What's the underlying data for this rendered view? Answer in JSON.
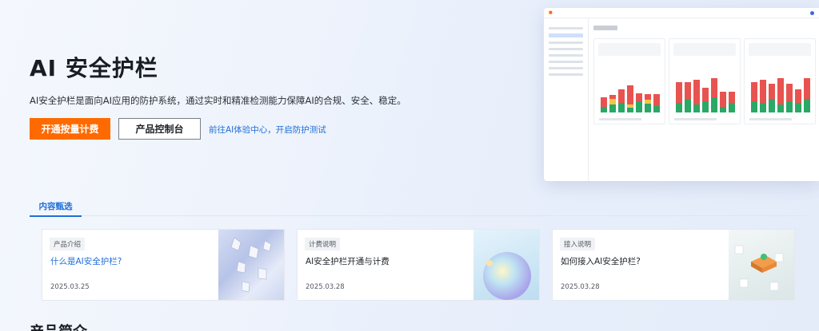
{
  "hero": {
    "title": "AI 安全护栏",
    "description": "AI安全护栏是面向AI应用的防护系统，通过实时和精准检测能力保障AI的合规、安全、稳定。",
    "primary_button": "开通按量计费",
    "secondary_button": "产品控制台",
    "link": "前往AI体验中心，开启防护测试"
  },
  "colors": {
    "accent": "#ff6a00",
    "link": "#1f6fd8",
    "bar_red": "#e9534f",
    "bar_green": "#2aa866",
    "bar_yellow": "#f5c644"
  },
  "tabs": [
    {
      "label": "内容甄选",
      "active": true
    }
  ],
  "cards": [
    {
      "tag": "产品介绍",
      "title": "什么是AI安全护栏?",
      "date": "2025.03.25",
      "highlighted": true
    },
    {
      "tag": "计费说明",
      "title": "AI安全护栏开通与计费",
      "date": "2025.03.28",
      "highlighted": false
    },
    {
      "tag": "接入说明",
      "title": "如何接入AI安全护栏?",
      "date": "2025.03.28",
      "highlighted": false
    }
  ],
  "section": {
    "title": "产品简介"
  }
}
